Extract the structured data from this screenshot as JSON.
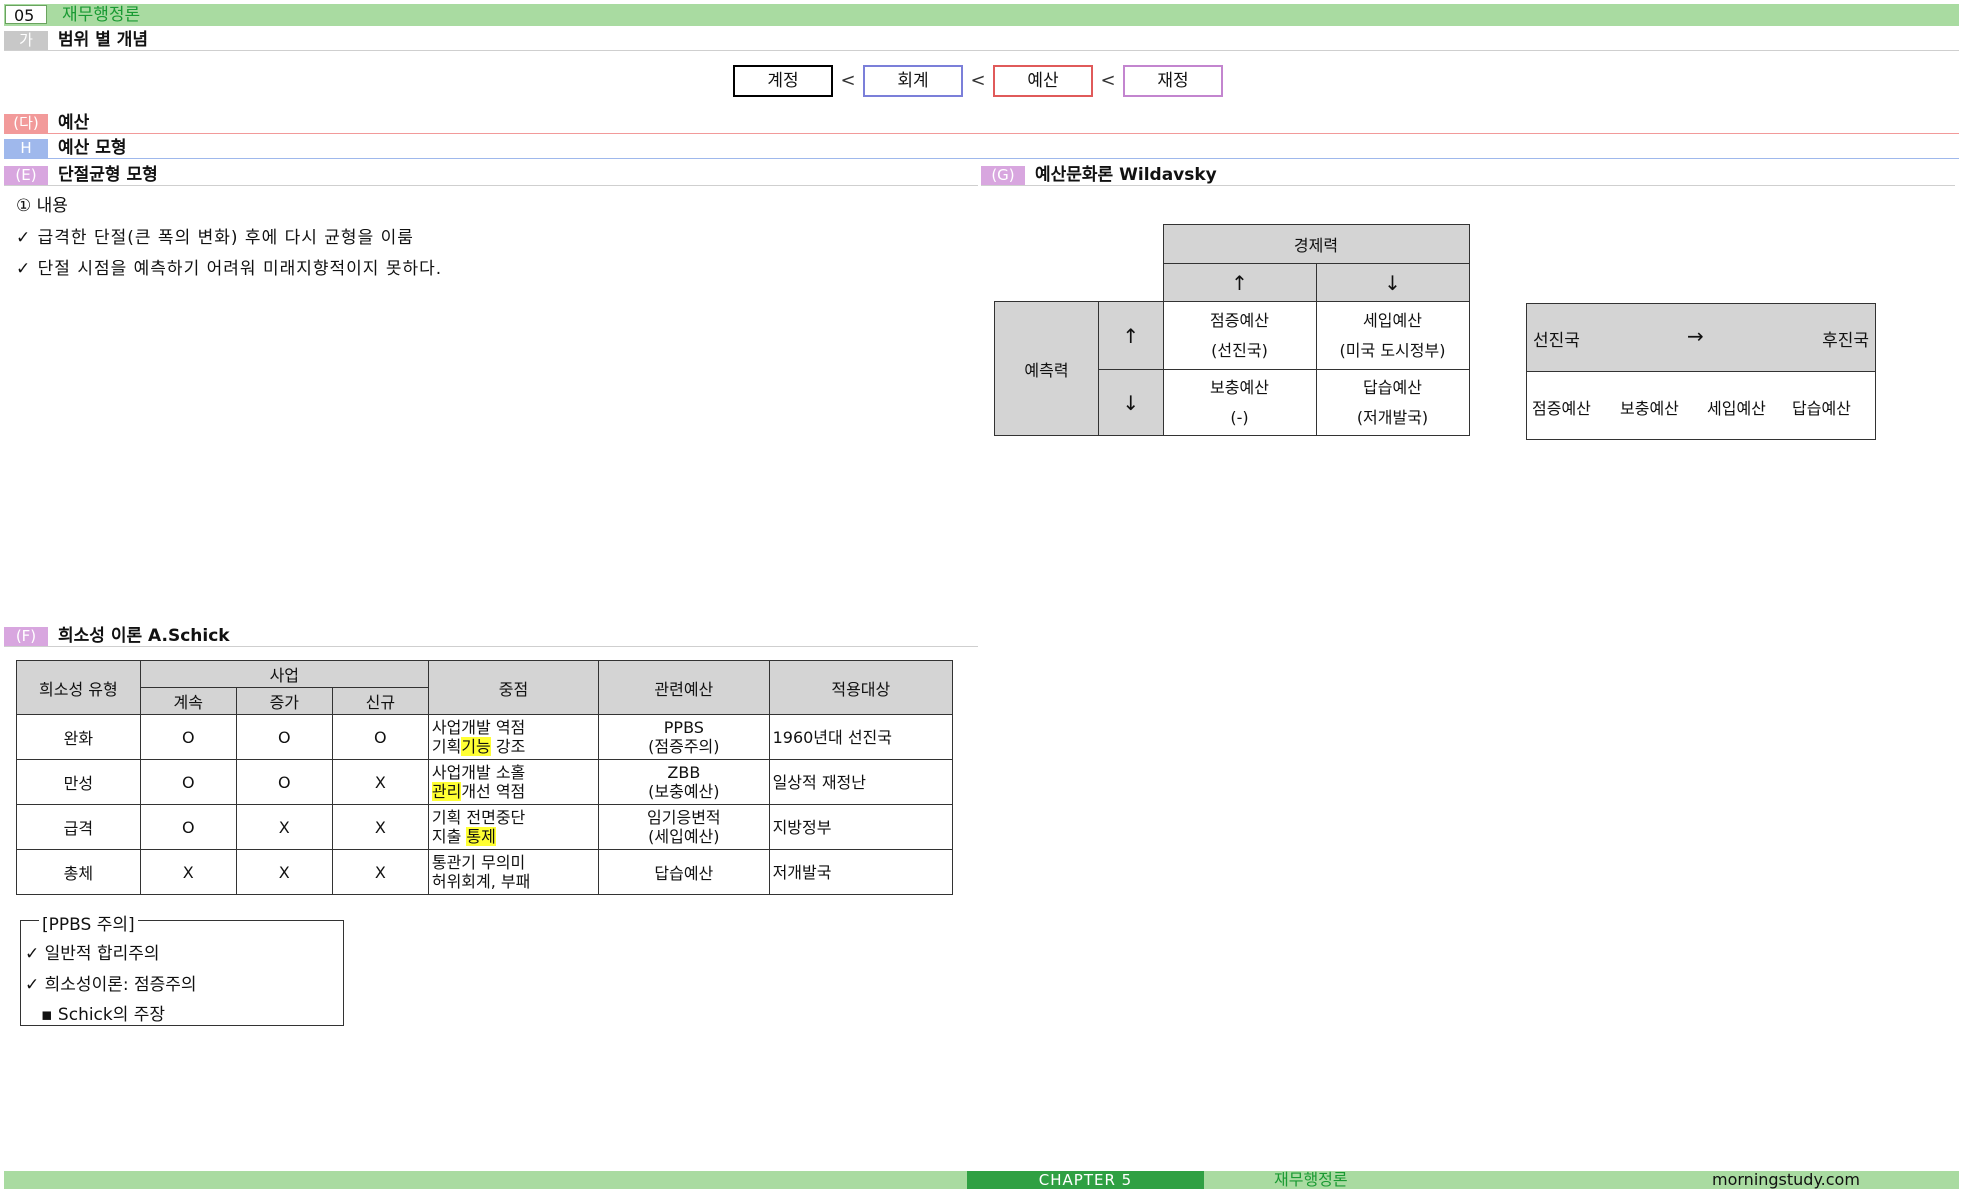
{
  "header": {
    "number": "05",
    "title": "재무행정론"
  },
  "section_ga": {
    "tag": "가",
    "title": "범위 별 개념"
  },
  "flow": {
    "items": [
      {
        "label": "계정",
        "color": "#000000"
      },
      {
        "label": "회계",
        "color": "#7b7fd9"
      },
      {
        "label": "예산",
        "color": "#e05a5a"
      },
      {
        "label": "재정",
        "color": "#c385cf"
      }
    ],
    "separator": "<"
  },
  "section_da": {
    "tag": "(다)",
    "title": "예산"
  },
  "section_h": {
    "tag": "H",
    "title": "예산 모형"
  },
  "section_e": {
    "tag": "(E)",
    "title": "단절균형 모형",
    "content_heading": "① 내용",
    "bullets": [
      "✓ 급격한 단절(큰 폭의 변화) 후에 다시 균형을 이룸",
      "✓ 단절 시점을 예측하기 어려워 미래지향적이지 못하다."
    ]
  },
  "section_g": {
    "tag": "(G)",
    "title": "예산문화론 Wildavsky",
    "matrix": {
      "col_header": "경제력",
      "col_up": "↑",
      "col_down": "↓",
      "row_header": "예측력",
      "row_up": "↑",
      "row_down": "↓",
      "cells": [
        [
          "점증예산",
          "(선진국)"
        ],
        [
          "세입예산",
          "(미국 도시정부)"
        ],
        [
          "보충예산",
          "(-)"
        ],
        [
          "답습예산",
          "(저개발국)"
        ]
      ]
    },
    "progression": {
      "from": "선진국",
      "arrow": "→",
      "to": "후진국",
      "stages": [
        "점증예산",
        "보충예산",
        "세입예산",
        "답습예산"
      ]
    }
  },
  "section_f": {
    "tag": "(F)",
    "title": "희소성 이론 A.Schick",
    "table": {
      "headers": {
        "type": "희소성 유형",
        "project": "사업",
        "sub": [
          "계속",
          "증가",
          "신규"
        ],
        "focus": "중점",
        "budget": "관련예산",
        "target": "적용대상"
      },
      "rows": [
        {
          "type": "완화",
          "marks": [
            "O",
            "O",
            "O"
          ],
          "focus_line1": "사업개발 역점",
          "focus_line2_pre": "기획",
          "focus_line2_hl": "기능",
          "focus_line2_post": " 강조",
          "budget_line1": "PPBS",
          "budget_line2": "(점증주의)",
          "target": "1960년대 선진국"
        },
        {
          "type": "만성",
          "marks": [
            "O",
            "O",
            "X"
          ],
          "focus_line1": "사업개발 소홀",
          "focus_line2_pre": "",
          "focus_line2_hl": "관리",
          "focus_line2_post": "개선 역점",
          "budget_line1": "ZBB",
          "budget_line2": "(보충예산)",
          "target": "일상적 재정난"
        },
        {
          "type": "급격",
          "marks": [
            "O",
            "X",
            "X"
          ],
          "focus_line1": "기획 전면중단",
          "focus_line2_pre": "지출 ",
          "focus_line2_hl": "통제",
          "focus_line2_post": "",
          "budget_line1": "임기응변적",
          "budget_line2": "(세입예산)",
          "target": "지방정부"
        },
        {
          "type": "총체",
          "marks": [
            "X",
            "X",
            "X"
          ],
          "focus_line1": "통관기 무의미",
          "focus_line2_pre": "허위회계, 부패",
          "focus_line2_hl": "",
          "focus_line2_post": "",
          "budget_line1": "답습예산",
          "budget_line2": "",
          "target": "저개발국"
        }
      ]
    },
    "note": {
      "title": "[PPBS 주의]",
      "items": [
        "✓ 일반적 합리주의",
        "✓ 희소성이론: 점증주의",
        "▪ Schick의 주장"
      ]
    }
  },
  "footer": {
    "chapter": "CHAPTER 5",
    "title": "재무행정론",
    "site": "morningstudy.com"
  }
}
